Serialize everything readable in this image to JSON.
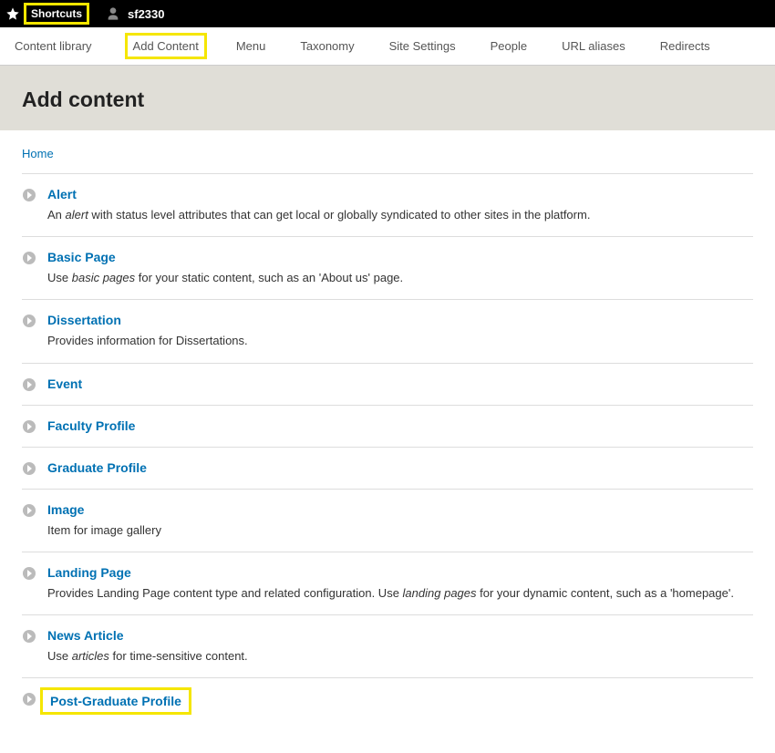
{
  "topbar": {
    "shortcuts_label": "Shortcuts",
    "username": "sf2330"
  },
  "tabs": [
    {
      "label": "Content library",
      "highlight": false
    },
    {
      "label": "Add Content",
      "highlight": true
    },
    {
      "label": "Menu",
      "highlight": false
    },
    {
      "label": "Taxonomy",
      "highlight": false
    },
    {
      "label": "Site Settings",
      "highlight": false
    },
    {
      "label": "People",
      "highlight": false
    },
    {
      "label": "URL aliases",
      "highlight": false
    },
    {
      "label": "Redirects",
      "highlight": false
    }
  ],
  "page_title": "Add content",
  "breadcrumb": {
    "home": "Home"
  },
  "items": [
    {
      "title": "Alert",
      "desc_pre": "An ",
      "desc_em": "alert",
      "desc_post": " with status level attributes that can get local or globally syndicated to other sites in the platform.",
      "highlight": false
    },
    {
      "title": "Basic Page",
      "desc_pre": "Use ",
      "desc_em": "basic pages",
      "desc_post": " for your static content, such as an 'About us' page.",
      "highlight": false
    },
    {
      "title": "Dissertation",
      "desc_pre": "Provides information for Dissertations.",
      "desc_em": "",
      "desc_post": "",
      "highlight": false
    },
    {
      "title": "Event",
      "desc_pre": "",
      "desc_em": "",
      "desc_post": "",
      "highlight": false
    },
    {
      "title": "Faculty Profile",
      "desc_pre": "",
      "desc_em": "",
      "desc_post": "",
      "highlight": false
    },
    {
      "title": "Graduate Profile",
      "desc_pre": "",
      "desc_em": "",
      "desc_post": "",
      "highlight": false
    },
    {
      "title": "Image",
      "desc_pre": "Item for image gallery",
      "desc_em": "",
      "desc_post": "",
      "highlight": false
    },
    {
      "title": "Landing Page",
      "desc_pre": "Provides Landing Page content type and related configuration. Use ",
      "desc_em": "landing pages",
      "desc_post": " for your dynamic content, such as a 'homepage'.",
      "highlight": false
    },
    {
      "title": "News Article",
      "desc_pre": "Use ",
      "desc_em": "articles",
      "desc_post": " for time-sensitive content.",
      "highlight": false
    },
    {
      "title": "Post-Graduate Profile",
      "desc_pre": "",
      "desc_em": "",
      "desc_post": "",
      "highlight": true
    }
  ]
}
